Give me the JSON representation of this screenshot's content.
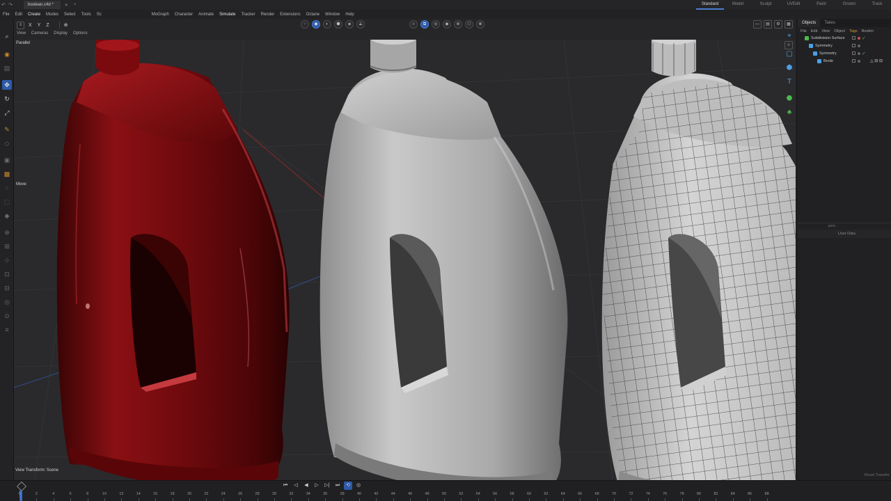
{
  "titlebar": {
    "document_tab": "boolean.c4d *",
    "layouts": [
      "Standard",
      "Model",
      "Sculpt",
      "UVEdit",
      "Paint",
      "Groom",
      "Track"
    ],
    "active_layout": "Standard"
  },
  "menubar": {
    "items": [
      "File",
      "Edit",
      "Create",
      "Modes",
      "Select",
      "Tools",
      "Sc",
      "MoGraph",
      "Character",
      "Animate",
      "Simulate",
      "Tracker",
      "Render",
      "Extensions",
      "Octane",
      "Window",
      "Help"
    ]
  },
  "viewport": {
    "axis_buttons": [
      "X",
      "Y",
      "Z"
    ],
    "menus": [
      "View",
      "Cameras",
      "Display",
      "Options"
    ],
    "projection_label": "Parallel",
    "tool_label": "Move",
    "view_transform_label": "View Transform: Scene",
    "colors": {
      "red_bottle": "#7a0a0e",
      "clay_bottle": "#b7b7b7",
      "wire_bottle": "#c9c9c9",
      "background": "#2a2a2c"
    }
  },
  "object_manager": {
    "tabs": [
      "Objects",
      "Takes"
    ],
    "active_tab": "Objects",
    "menu": [
      "File",
      "Edit",
      "View",
      "Object",
      "Tags",
      "Bookm"
    ],
    "objects": [
      {
        "name": "Subdivision Surface",
        "indent": 0,
        "icon_color": "#4dba4d",
        "checked": true
      },
      {
        "name": "Symmetry",
        "indent": 1,
        "icon_color": "#4aa0e8",
        "checked": false
      },
      {
        "name": "Symmetry",
        "indent": 2,
        "icon_color": "#4aa0e8",
        "checked": true
      },
      {
        "name": "Boole",
        "indent": 3,
        "icon_color": "#4aa0e8",
        "checked": false
      }
    ],
    "boole_tags": "△ ⊟ ⊟",
    "attributes_header": "yers",
    "attributes_tab": "User Data",
    "reset_label": "Reset Transfor"
  },
  "timeline": {
    "frames": [
      "0",
      "2",
      "4",
      "6",
      "8",
      "10",
      "12",
      "14",
      "16",
      "18",
      "20",
      "22",
      "24",
      "26",
      "28",
      "30",
      "32",
      "34",
      "36",
      "38",
      "40",
      "42",
      "44",
      "46",
      "48",
      "50",
      "52",
      "54",
      "56",
      "58",
      "60",
      "62",
      "64",
      "66",
      "68",
      "70",
      "72",
      "74",
      "76",
      "78",
      "80",
      "82",
      "84",
      "86",
      "88"
    ],
    "current_frame": 0
  }
}
